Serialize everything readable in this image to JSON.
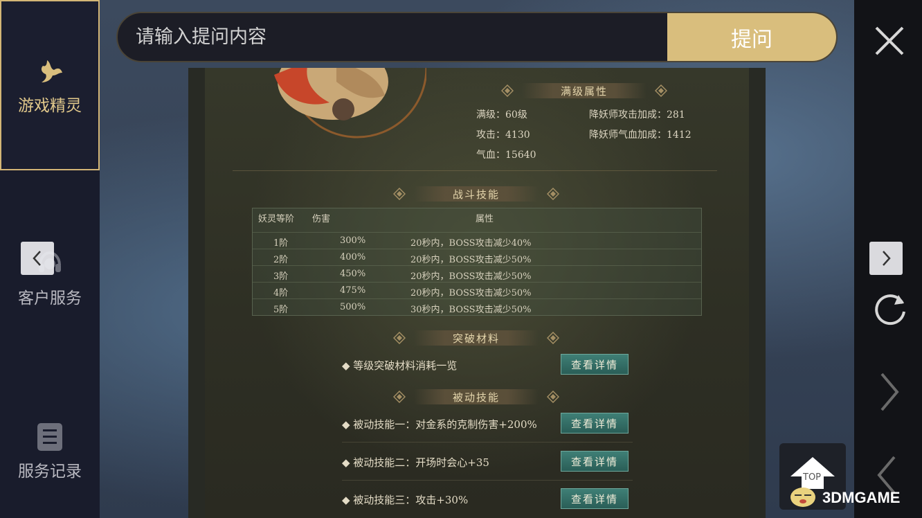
{
  "search": {
    "placeholder": "请输入提问内容",
    "ask_label": "提问"
  },
  "sidebar": {
    "items": [
      {
        "label": "游戏精灵",
        "icon": "fairy-icon",
        "active": true
      },
      {
        "label": "客户服务",
        "icon": "headset-icon",
        "active": false
      },
      {
        "label": "服务记录",
        "icon": "list-icon",
        "active": false
      }
    ]
  },
  "content": {
    "full_level": {
      "title": "满级属性",
      "level": "满级：60级",
      "attack": "攻击：4130",
      "hp": "气血：15640",
      "demon_attack": "降妖师攻击加成：281",
      "demon_hp": "降妖师气血加成：1412"
    },
    "battle_skill": {
      "title": "战斗技能",
      "headers": [
        "妖灵等阶",
        "伤害",
        "属性"
      ],
      "rows": [
        [
          "1阶",
          "300%",
          "20秒内，BOSS攻击减少40%"
        ],
        [
          "2阶",
          "400%",
          "20秒内，BOSS攻击减少50%"
        ],
        [
          "3阶",
          "450%",
          "20秒内，BOSS攻击减少50%"
        ],
        [
          "4阶",
          "475%",
          "20秒内，BOSS攻击减少50%"
        ],
        [
          "5阶",
          "500%",
          "30秒内，BOSS攻击减少50%"
        ]
      ]
    },
    "breakthrough": {
      "title": "突破材料",
      "items": [
        {
          "text": "◆ 等级突破材料消耗一览",
          "button": "查看详情"
        }
      ]
    },
    "passive": {
      "title": "被动技能",
      "items": [
        {
          "text": "◆ 被动技能一：对金系的克制伤害+200%",
          "button": "查看详情"
        },
        {
          "text": "◆ 被动技能二：开场时会心+35",
          "button": "查看详情"
        },
        {
          "text": "◆ 被动技能三：攻击+30%",
          "button": "查看详情"
        }
      ]
    }
  },
  "top_button": {
    "label": "TOP"
  },
  "watermark": "3DMGAME",
  "colors": {
    "accent": "#d9be7d",
    "sidebar_bg": "#191c2c",
    "detail_button": "#2f6a62"
  }
}
